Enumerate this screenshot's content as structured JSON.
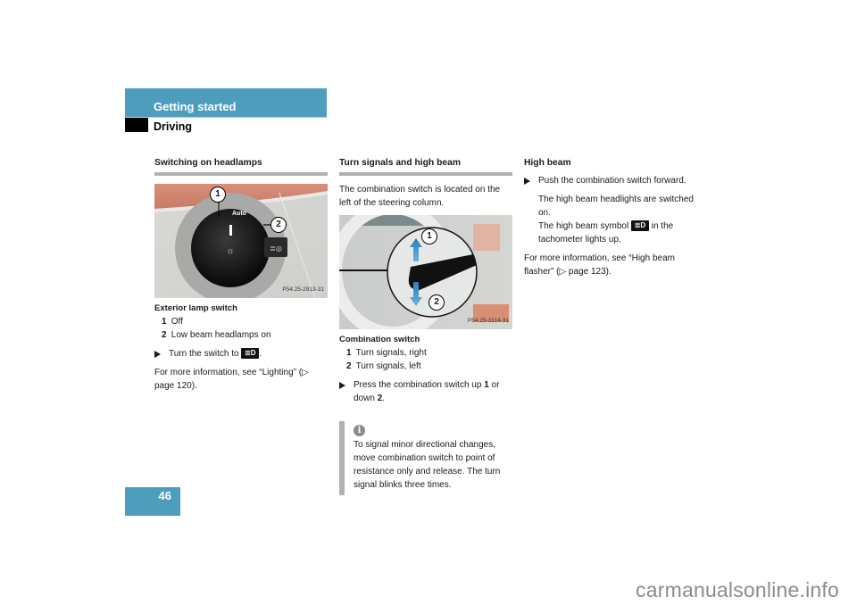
{
  "header": {
    "section": "Getting started",
    "subsection": "Driving"
  },
  "colors": {
    "accent": "#4f9dbd",
    "rule": "#b1b1b1"
  },
  "col1": {
    "title": "Switching on headlamps",
    "figure": {
      "photo_id": "P54.25-2913-31",
      "callouts": [
        "1",
        "2"
      ],
      "dial_labels": [
        "Auto"
      ]
    },
    "caption": "Exterior lamp switch",
    "legend": [
      {
        "n": "1",
        "text": "Off"
      },
      {
        "n": "2",
        "text": "Low beam headlamps on"
      }
    ],
    "step": {
      "text": "Turn the switch to",
      "symbol": "low-beam-symbol",
      "symbol_glyph": "≣D",
      "after": "."
    },
    "more_info": "For more information, see “Lighting” (▷ page 120)."
  },
  "col2": {
    "title": "Turn signals and high beam",
    "intro": "The combination switch is located on the left of the steering column.",
    "figure": {
      "photo_id": "P54.25-3114-31",
      "callouts": [
        "1",
        "2"
      ]
    },
    "caption": "Combination switch",
    "legend": [
      {
        "n": "1",
        "text": "Turn signals, right"
      },
      {
        "n": "2",
        "text": "Turn signals, left"
      }
    ],
    "step": {
      "pre": "Press the combination switch up ",
      "n1": "1",
      "mid": " or down ",
      "n2": "2",
      "post": "."
    },
    "info": {
      "icon": "info-icon",
      "glyph": "i",
      "text": "To signal minor directional changes, move combination switch to point of resistance only and release. The turn signal blinks three times."
    }
  },
  "col3": {
    "title": "High beam",
    "step": "Push the combination switch forward.",
    "result1": "The high beam headlights are switched on.",
    "result2_pre": "The high beam symbol",
    "symbol_glyph": "≣D",
    "result2_post": "in the tachometer lights up.",
    "more_info": "For more information, see “High beam flasher” (▷ page 123)."
  },
  "footer": {
    "page_number": "46",
    "watermark": "carmanualsonline.info"
  }
}
